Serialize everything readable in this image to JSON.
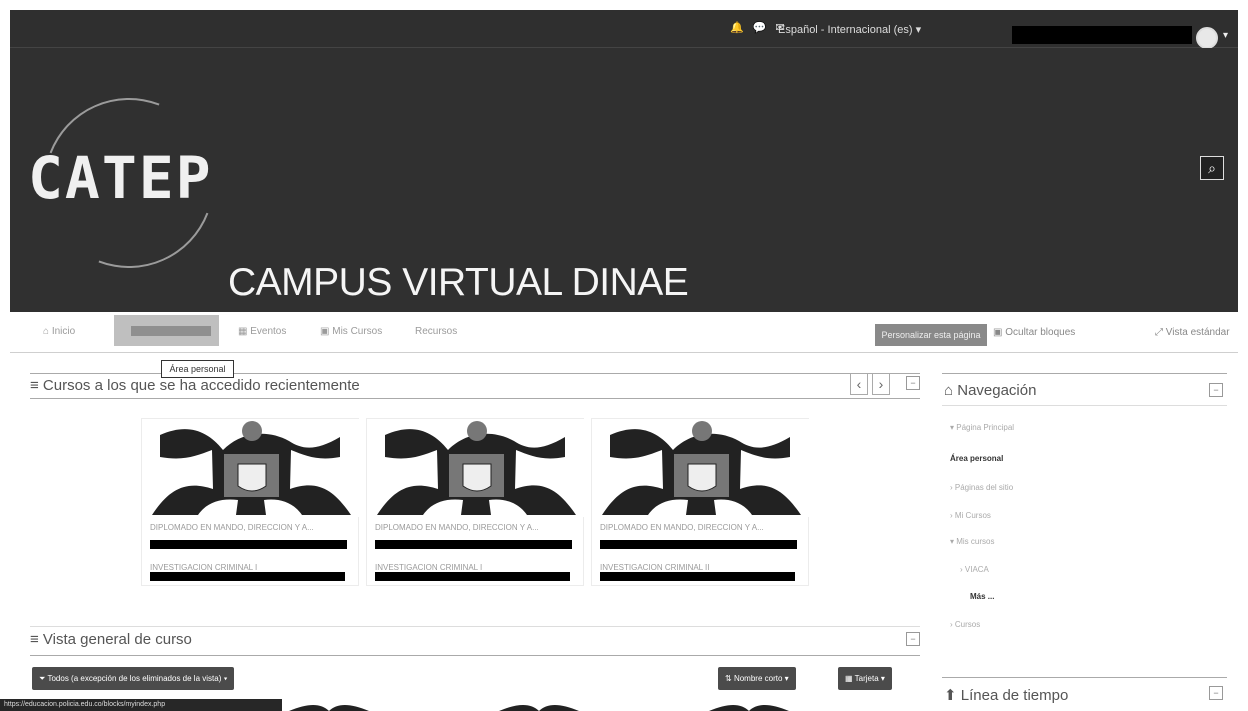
{
  "header": {
    "language": "Español - Internacional (es) ▾",
    "site_title": "CAMPUS VIRTUAL DINAE",
    "logo_text": "CATEP"
  },
  "nav": {
    "inicio": "Inicio",
    "eventos": "Eventos",
    "mis_cursos": "Mis Cursos",
    "recursos": "Recursos",
    "tooltip": "Área personal",
    "personalize": "Personalizar esta página",
    "hide_blocks": "Ocultar bloques",
    "standard_view": "Vista estándar"
  },
  "recent": {
    "title": "Cursos a los que se ha accedido recientemente",
    "cards": [
      {
        "title": "DIPLOMADO EN MANDO, DIRECCION Y A...",
        "subtitle": "INVESTIGACION CRIMINAL I"
      },
      {
        "title": "DIPLOMADO EN MANDO, DIRECCION Y A...",
        "subtitle": "INVESTIGACION CRIMINAL I"
      },
      {
        "title": "DIPLOMADO EN MANDO, DIRECCION Y A...",
        "subtitle": "INVESTIGACION CRIMINAL II"
      }
    ]
  },
  "overview": {
    "title": "Vista general de curso",
    "filter": "Todos (a excepción de los eliminados de la vista) ▾",
    "sort": "Nombre corto ▾",
    "view": "Tarjeta ▾"
  },
  "navigation": {
    "title": "Navegación",
    "items": [
      "▾ Página Principal",
      "Área personal",
      "› Páginas del sitio",
      "› Mi Cursos",
      "▾ Mis cursos",
      "› VIACA",
      "Más ...",
      "› Cursos"
    ]
  },
  "timeline": {
    "title": "Línea de tiempo"
  },
  "status": {
    "url": "https://educacion.policia.edu.co/blocks/myindex.php"
  },
  "icons": {
    "menu": "≡",
    "home": "⌂",
    "calendar": "▦",
    "search": "⌕",
    "minimize": "−"
  }
}
